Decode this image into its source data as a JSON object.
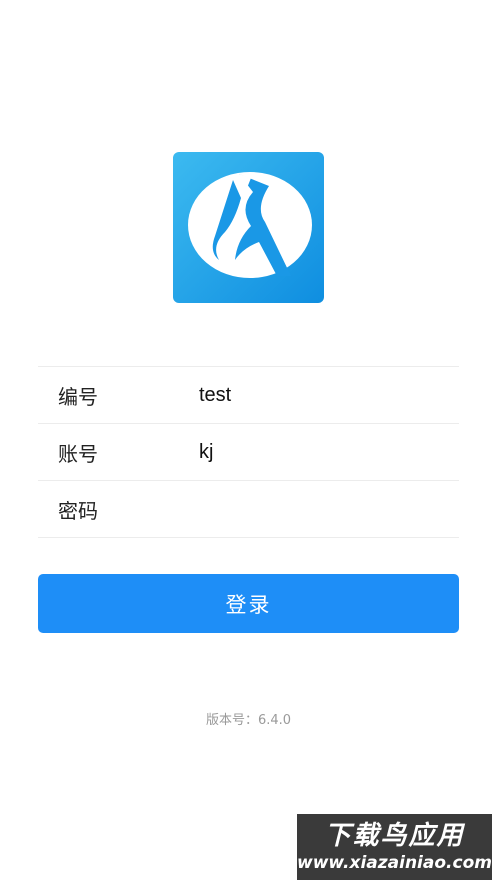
{
  "logo": {
    "icon": "app-logo-icon",
    "colors": {
      "background_top": "#3cbaf0",
      "background_bottom": "#0f8ee0",
      "mark": "#ffffff"
    }
  },
  "form": {
    "fields": [
      {
        "label": "编号",
        "value": "test",
        "type": "text"
      },
      {
        "label": "账号",
        "value": "kj",
        "type": "text"
      },
      {
        "label": "密码",
        "value": "",
        "type": "password"
      }
    ]
  },
  "login_button": {
    "label": "登录",
    "color": "#1e8ef7"
  },
  "version": {
    "label": "版本号：",
    "number": "6.4.0"
  },
  "watermark": {
    "title": "下载鸟应用",
    "url": "www.xiazainiao.com"
  }
}
